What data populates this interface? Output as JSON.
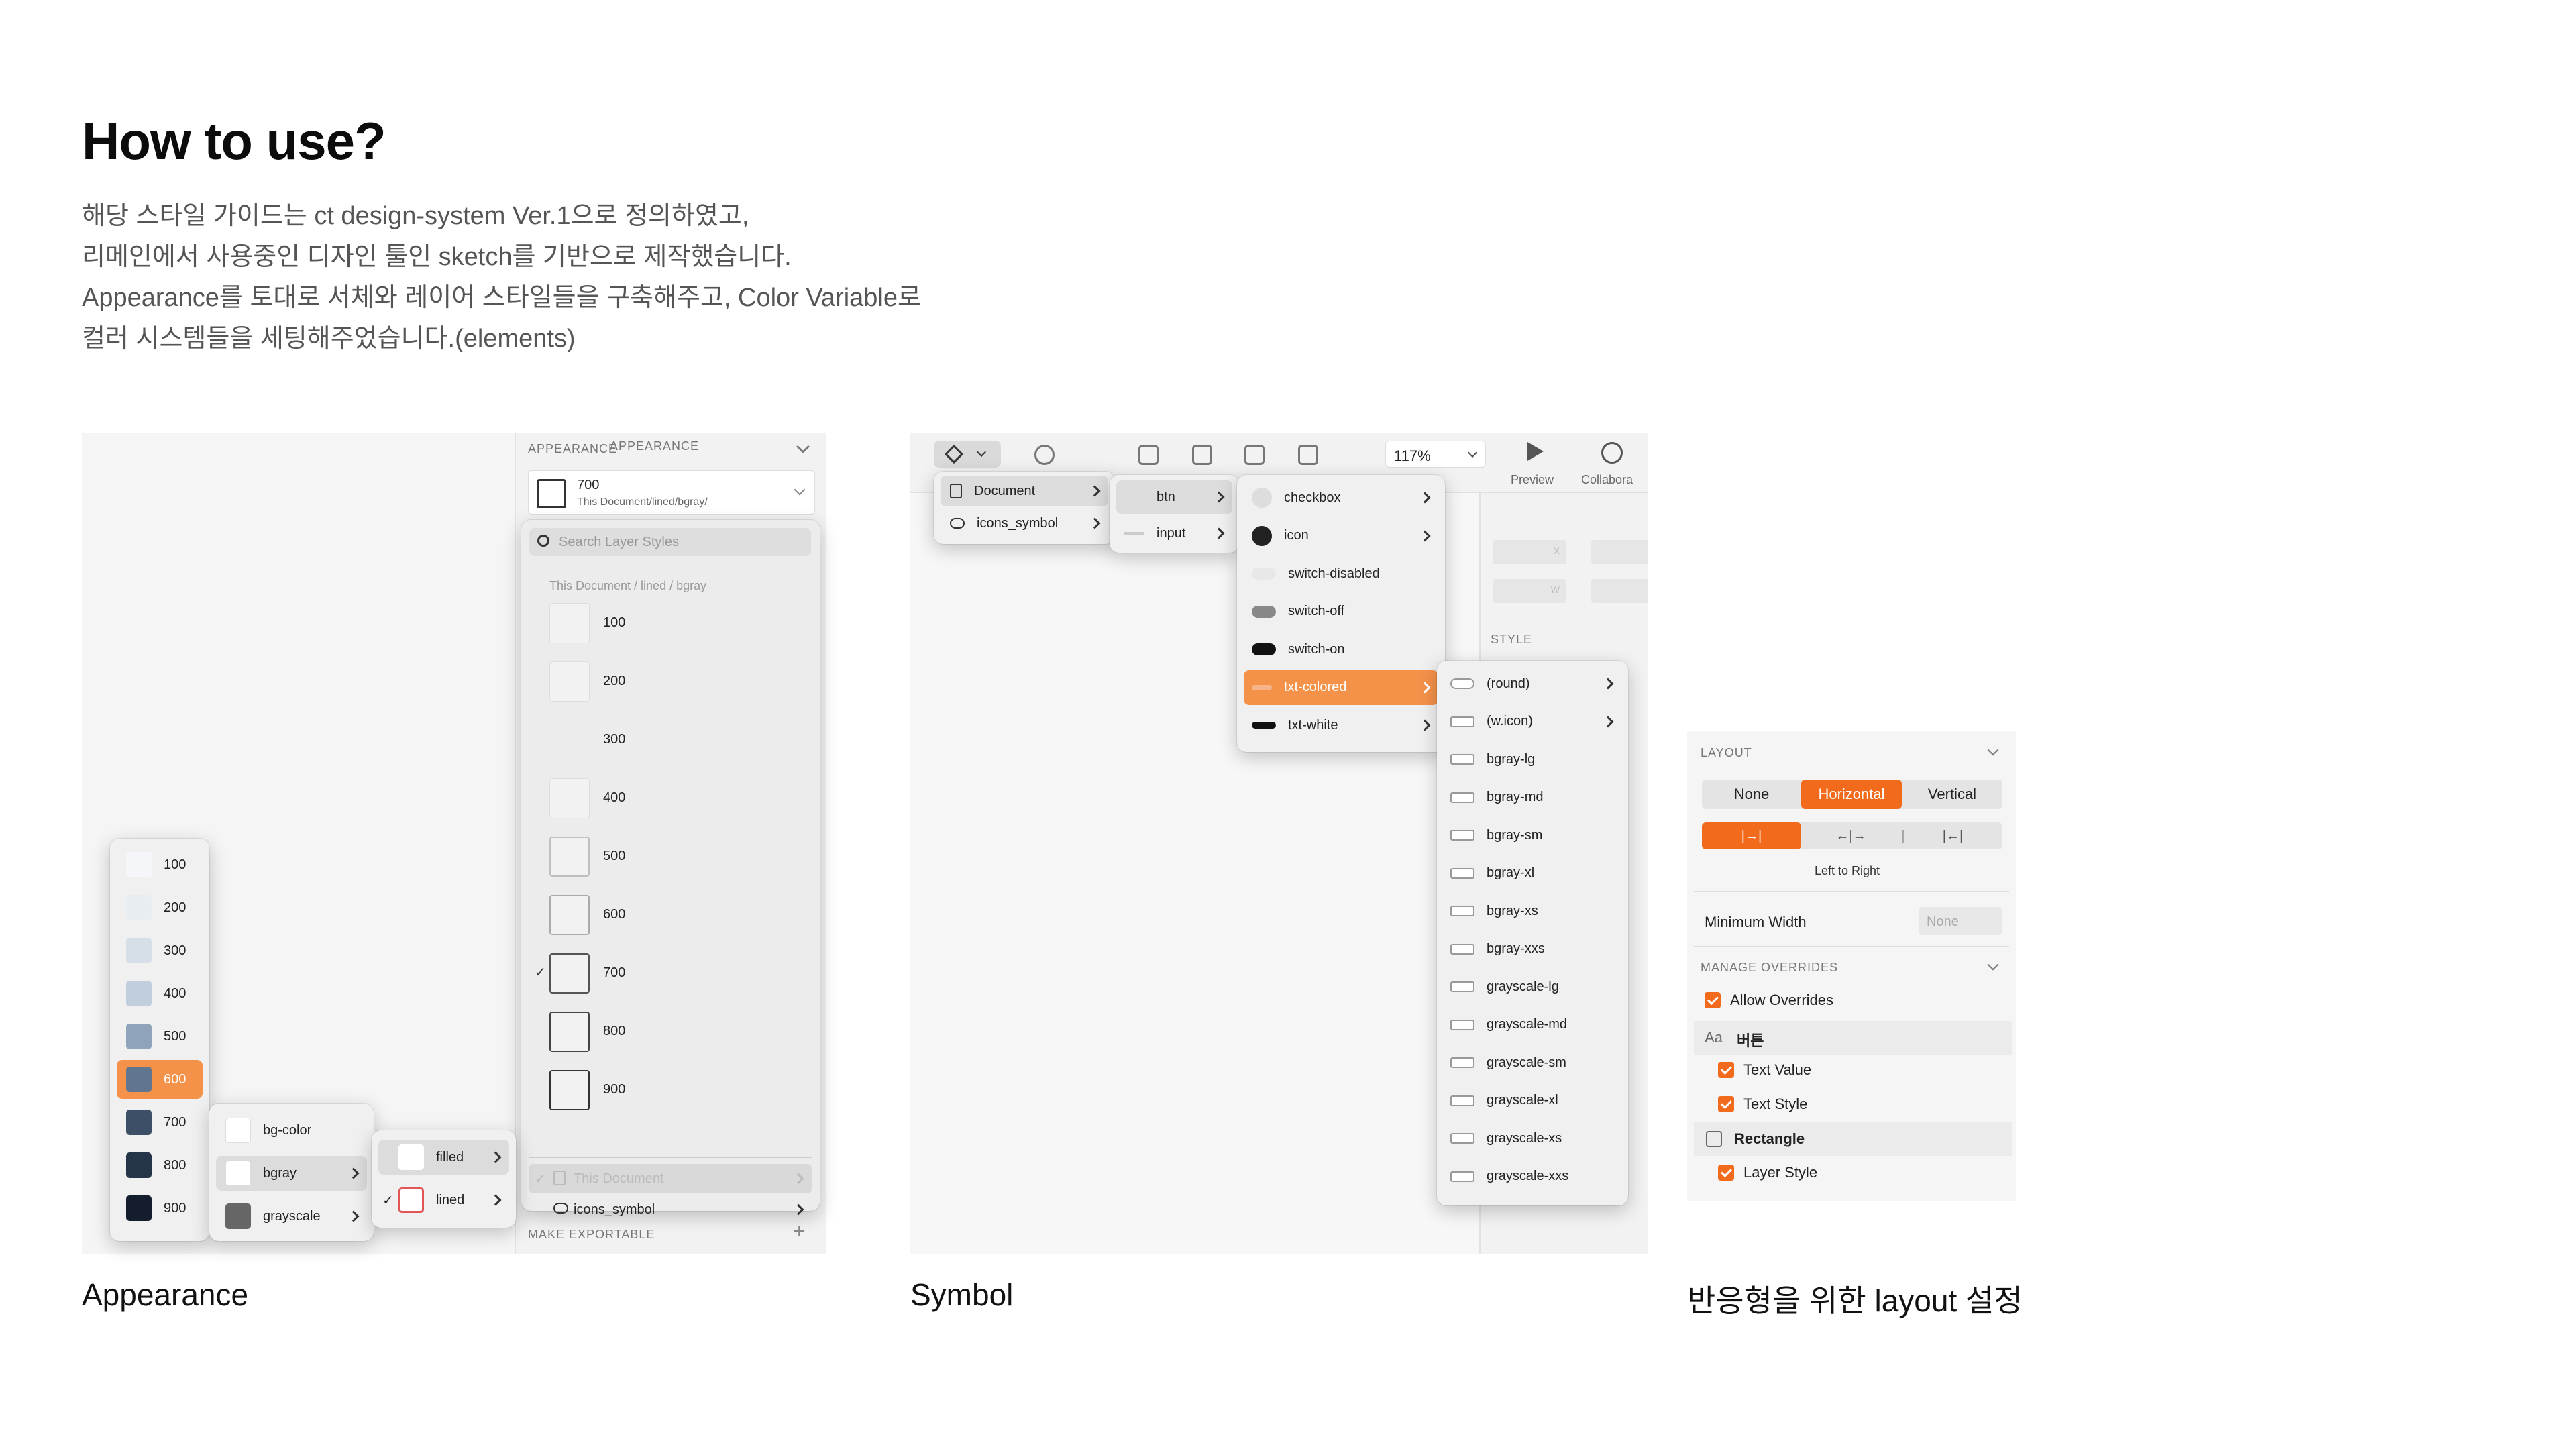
{
  "header": {
    "title": "How to use?",
    "lines": [
      "해당 스타일 가이드는 ct design-system Ver.1으로 정의하였고,",
      "리메인에서 사용중인 디자인 툴인 sketch를 기반으로 제작했습니다.",
      "Appearance를 토대로 서체와 레이어 스타일들을 구축해주고, Color Variable로",
      "컬러 시스템들을 세팅해주었습니다.(elements)"
    ]
  },
  "captions": {
    "appearance": "Appearance",
    "symbol": "Symbol",
    "layout": "반응형을 위한 layout 설정"
  },
  "appearance": {
    "section_title": "APPEARANCE",
    "current_style": {
      "name": "700",
      "path": "This Document/lined/bgray/"
    },
    "search_placeholder": "Search Layer Styles",
    "list_header": "This Document / lined / bgray",
    "styles": [
      "100",
      "200",
      "300",
      "400",
      "500",
      "600",
      "700",
      "800",
      "900"
    ],
    "selected_style": "700",
    "source_items": [
      "This Document",
      "icons_symbol"
    ],
    "make_exportable": "MAKE EXPORTABLE",
    "plus": "+",
    "check": "✓",
    "color_menu": [
      {
        "label": "100",
        "color": "#f4f6f9"
      },
      {
        "label": "200",
        "color": "#e8edf2"
      },
      {
        "label": "300",
        "color": "#d6dee7"
      },
      {
        "label": "400",
        "color": "#c0cedd"
      },
      {
        "label": "500",
        "color": "#8fa3ba"
      },
      {
        "label": "600",
        "color": "#5f7590"
      },
      {
        "label": "700",
        "color": "#3d4f67"
      },
      {
        "label": "800",
        "color": "#263449"
      },
      {
        "label": "900",
        "color": "#141d2b"
      }
    ],
    "selected_color": "600",
    "group_menu": [
      "bg-color",
      "bgray",
      "grayscale"
    ],
    "type_menu": [
      "filled",
      "lined"
    ],
    "accent": "#f4924a"
  },
  "symbol": {
    "zoom": "117%",
    "preview": "Preview",
    "collaborate": "Collabora",
    "style_label": "STYLE",
    "level1": [
      "Document",
      "icons_symbol"
    ],
    "level2": [
      "btn",
      "input"
    ],
    "level3": [
      "checkbox",
      "icon",
      "switch-disabled",
      "switch-off",
      "switch-on",
      "txt-colored",
      "txt-white"
    ],
    "level3_selected": "txt-colored",
    "level4": [
      "(round)",
      "(w.icon)",
      "bgray-lg",
      "bgray-md",
      "bgray-sm",
      "bgray-xl",
      "bgray-xs",
      "bgray-xxs",
      "grayscale-lg",
      "grayscale-md",
      "grayscale-sm",
      "grayscale-xl",
      "grayscale-xs",
      "grayscale-xxs"
    ],
    "ruler_x": "X",
    "ruler_w": "W"
  },
  "layout": {
    "section_title": "LAYOUT",
    "modes": [
      "None",
      "Horizontal",
      "Vertical"
    ],
    "active_mode": "Horizontal",
    "direction_caption": "Left to Right",
    "direction_icons": [
      "|→|",
      "←|→",
      "|",
      "|←|"
    ],
    "min_width_label": "Minimum Width",
    "min_width_value": "None",
    "overrides_title": "MANAGE OVERRIDES",
    "allow_overrides": "Allow Overrides",
    "text_group_prefix": "Aa",
    "text_group": "버튼",
    "text_value": "Text Value",
    "text_style": "Text Style",
    "shape_group": "Rectangle",
    "layer_style": "Layer Style",
    "accent": "#f26b1d"
  }
}
